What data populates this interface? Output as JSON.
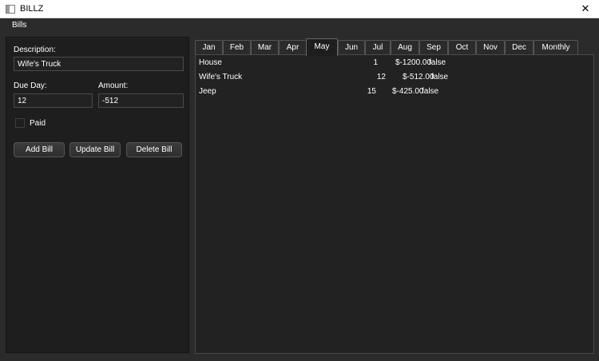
{
  "window": {
    "title": "BILLZ",
    "close_glyph": "✕"
  },
  "menu": {
    "items": [
      "Bills"
    ]
  },
  "form": {
    "description_label": "Description:",
    "description_value": "Wife's Truck",
    "due_day_label": "Due Day:",
    "due_day_value": "12",
    "amount_label": "Amount:",
    "amount_value": "-512",
    "paid_label": "Paid",
    "paid_checked": false,
    "add_label": "Add Bill",
    "update_label": "Update Bill",
    "delete_label": "Delete Bill"
  },
  "tabs": [
    "Jan",
    "Feb",
    "Mar",
    "Apr",
    "May",
    "Jun",
    "Jul",
    "Aug",
    "Sep",
    "Oct",
    "Nov",
    "Dec",
    "Monthly"
  ],
  "active_tab": "May",
  "bills": [
    {
      "name": "House",
      "day": "1",
      "amount": "$-1200.00",
      "paid": "false"
    },
    {
      "name": "Wife's Truck",
      "day": "12",
      "amount": "$-512.00",
      "paid": "false"
    },
    {
      "name": "Jeep",
      "day": "15",
      "amount": "$-425.00",
      "paid": "false"
    }
  ]
}
